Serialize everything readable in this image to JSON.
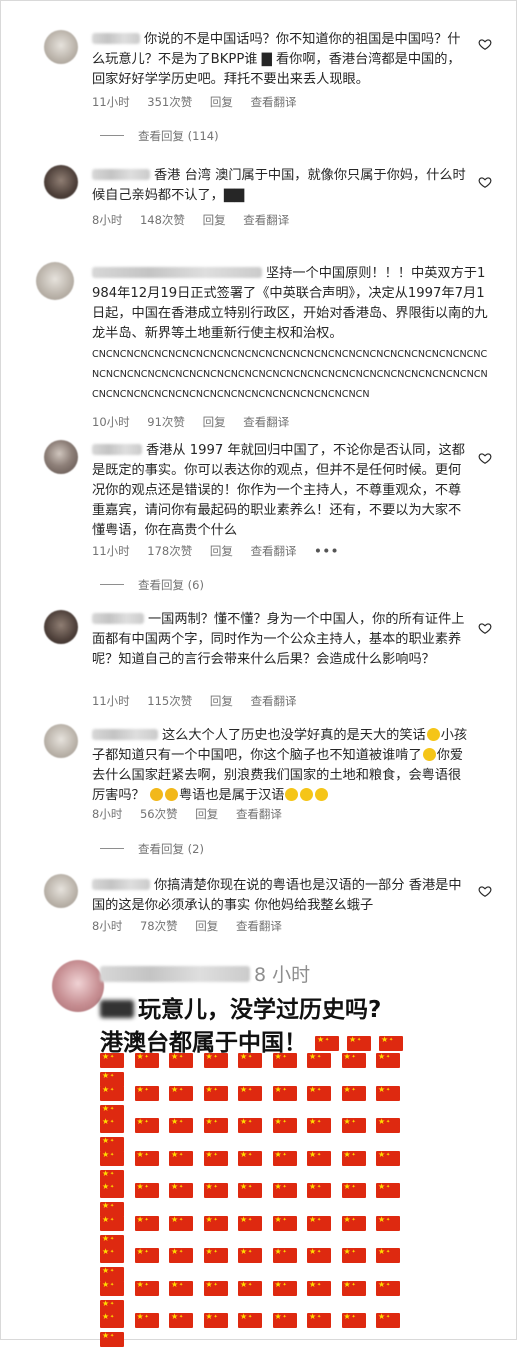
{
  "comments": [
    {
      "text": "你说的不是中国话吗？你不知道你的祖国是中国吗？什么玩意儿？不是为了BKPP谁 ▇ 看你啊，香港台湾都是中国的，回家好好学学历史吧。拜托不要出来丢人现眼。",
      "time": "11小时",
      "likes": "351次赞",
      "reply": "回复",
      "translate": "查看翻译",
      "view_replies": "查看回复 (114)"
    },
    {
      "text": "香港 台湾 澳门属于中国，就像你只属于你妈，什么时候自己亲妈都不认了，▇▇",
      "time": "8小时",
      "likes": "148次赞",
      "reply": "回复",
      "translate": "查看翻译"
    },
    {
      "text": "坚持一个中国原则！！！中英双方于1984年12月19日正式签署了《中英联合声明》，决定从1997年7月1日起，中国在香港成立特别行政区，开始对香港岛、界限街以南的九龙半岛、新界等土地重新行使主权和治权。",
      "spam": "CNCNCNCNCNCNCNCNCNCNCNCNCNCNCNCNCNCNCNCNCNCNCNCNCNCNCNCNCNCNCNCNCNCNCNCNCNCNCNCNCNCNCNCNCNCNCNCNCNCNCNCNCNCNCNCNCNCNCNCNCNCNCNCNCNCNCNCNCNCNCNCNCNCNCNCNCN",
      "time": "10小时",
      "likes": "91次赞",
      "reply": "回复",
      "translate": "查看翻译"
    },
    {
      "text": "香港从 1997 年就回归中国了，不论你是否认同，这都是既定的事实。你可以表达你的观点，但并不是任何时候。更何况你的观点还是错误的！你作为一个主持人，不尊重观众，不尊重嘉宾，请问你有最起码的职业素养么！还有，不要以为大家不懂粤语，你在高贵个什么",
      "time": "11小时",
      "likes": "178次赞",
      "reply": "回复",
      "translate": "查看翻译",
      "more": "•••",
      "view_replies": "查看回复 (6)"
    },
    {
      "text": "一国两制？懂不懂？身为一个中国人，你的所有证件上面都有中国两个字，同时作为一个公众主持人，基本的职业素养呢？知道自己的言行会带来什么后果？会造成什么影响吗？",
      "time": "11小时",
      "likes": "115次赞",
      "reply": "回复",
      "translate": "查看翻译"
    },
    {
      "text_a": "这么大个人了历史也没学好真的是天大的笑话",
      "text_b": "小孩子都知道只有一个中国吧，你这个脑子也不知道被谁啃了",
      "text_c": "你爱去什么国家赶紧去啊，别浪费我们国家的土地和粮食，会粤语很厉害吗？",
      "text_d": "粤语也是属于汉语",
      "time": "8小时",
      "likes": "56次赞",
      "reply": "回复",
      "translate": "查看翻译",
      "view_replies": "查看回复 (2)"
    },
    {
      "text": "你搞清楚你现在说的粤语也是汉语的一部分 香港是中国的这是你必须承认的事实 你他妈给我整幺蛾子",
      "time": "8小时",
      "likes": "78次赞",
      "reply": "回复",
      "translate": "查看翻译"
    }
  ],
  "big_comment": {
    "time": "8 小时",
    "line1": "玩意儿，没学过历史吗?",
    "line2": "港澳台都属于中国！",
    "flag_rows": 9,
    "flags_per_row": 10
  },
  "colors": {
    "flag_red": "#de2910",
    "flag_star": "#ffde00",
    "meta_gray": "#737373"
  }
}
